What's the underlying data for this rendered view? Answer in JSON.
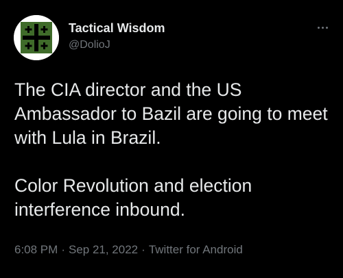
{
  "author": {
    "display_name": "Tactical Wisdom",
    "handle": "@DolioJ",
    "avatar_icon": "green-square-with-jerusalem-cross-icon"
  },
  "more_icon": "ellipsis-icon",
  "tweet": {
    "paragraphs": [
      "The CIA director and the US Ambassador to Bazil are going to meet with Lula in Brazil.",
      "Color Revolution and election interference inbound."
    ],
    "time": "6:08 PM",
    "date": "Sep 21, 2022",
    "source": "Twitter for Android",
    "separator": "·"
  },
  "colors": {
    "background": "#000000",
    "text_primary": "#e7e9ea",
    "text_secondary": "#71767b",
    "avatar_green": "#3f6b2a"
  }
}
